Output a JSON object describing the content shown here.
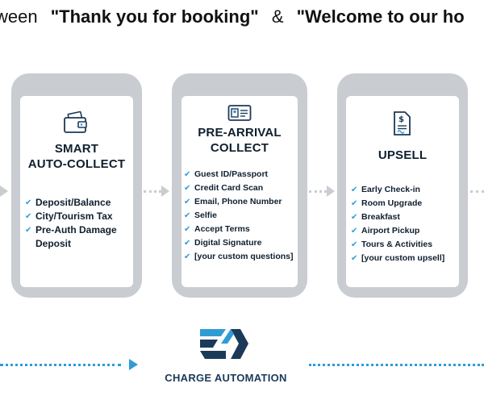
{
  "headline": {
    "lead": "ween",
    "booking_quote": "\"Thank you for booking\"",
    "amp": "&",
    "welcome_quote": "\"Welcome to our ho"
  },
  "cards": [
    {
      "icon": "wallet-card-icon",
      "title_line1": "SMART",
      "title_line2": "AUTO-COLLECT",
      "items": [
        "Deposit/Balance",
        "City/Tourism Tax",
        "Pre-Auth Damage Deposit"
      ]
    },
    {
      "icon": "id-card-icon",
      "title_line1": "PRE-ARRIVAL",
      "title_line2": "COLLECT",
      "items": [
        "Guest ID/Passport",
        "Credit Card Scan",
        "Email, Phone Number",
        "Selfie",
        "Accept Terms",
        "Digital Signature",
        "[your custom questions]"
      ]
    },
    {
      "icon": "signed-document-icon",
      "title_line1": "UPSELL",
      "items": [
        "Early Check-in",
        "Room Upgrade",
        "Breakfast",
        "Airport Pickup",
        "Tours & Activities",
        "[your custom upsell]"
      ]
    }
  ],
  "brand": {
    "name": "CHARGE AUTOMATION",
    "logo_icon": "charge-automation-logo-icon"
  },
  "colors": {
    "phone_frame": "#c9ccd1",
    "check": "#2f9cd6",
    "timeline": "#2f9cd6",
    "logo_dark": "#1b3a5a",
    "logo_light": "#2f9cd6"
  }
}
